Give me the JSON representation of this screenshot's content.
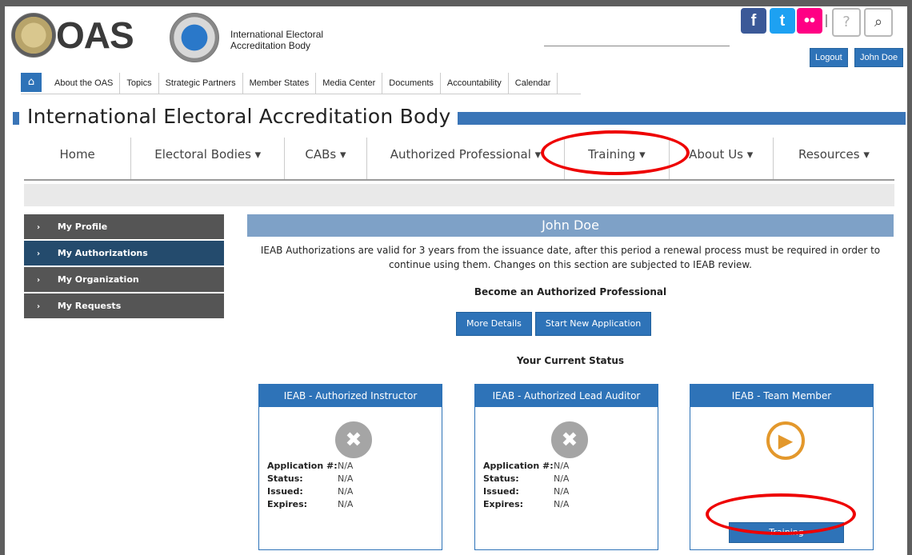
{
  "header": {
    "brand": "OAS",
    "caption": "International Electoral\nAccreditation Body",
    "social": {
      "facebook": "f",
      "twitter": "t",
      "flickr": "••"
    },
    "help": "?",
    "search": "⌕",
    "logout": "Logout",
    "user": "John Doe"
  },
  "oas_nav": {
    "home": "⌂",
    "items": [
      "About the OAS",
      "Topics",
      "Strategic Partners",
      "Member States",
      "Media Center",
      "Documents",
      "Accountability",
      "Calendar"
    ]
  },
  "page_title": "International Electoral Accreditation Body",
  "main_nav": {
    "items": [
      {
        "label": "Home",
        "width": 134
      },
      {
        "label": "Electoral Bodies ▾",
        "width": 192
      },
      {
        "label": "CABs ▾",
        "width": 102
      },
      {
        "label": "Authorized Professional ▾",
        "width": 248
      },
      {
        "label": "Training ▾",
        "width": 130
      },
      {
        "label": "About Us ▾",
        "width": 130
      },
      {
        "label": "Resources ▾",
        "width": 152
      }
    ]
  },
  "sidebar": {
    "items": [
      {
        "label": "My Profile",
        "active": false
      },
      {
        "label": "My Authorizations",
        "active": true
      },
      {
        "label": "My Organization",
        "active": false
      },
      {
        "label": "My Requests",
        "active": false
      }
    ]
  },
  "content": {
    "user_banner": "John Doe",
    "notice": "IEAB Authorizations are valid for 3 years from the issuance date, after this period a renewal process must be required in order to continue using them. Changes on this section are subjected to IEAB review.",
    "become_heading": "Become an Authorized Professional",
    "more_details": "More Details",
    "start_application": "Start New Application",
    "current_status": "Your Current Status"
  },
  "cards": [
    {
      "title": "IEAB - Authorized Instructor",
      "icon": "✖",
      "application_label": "Application #:",
      "application_value": "N/A",
      "status_label": "Status:",
      "status_value": "N/A",
      "issued_label": "Issued:",
      "issued_value": "N/A",
      "expires_label": "Expires:",
      "expires_value": "N/A"
    },
    {
      "title": "IEAB - Authorized Lead Auditor",
      "icon": "✖",
      "application_label": "Application #:",
      "application_value": "N/A",
      "status_label": "Status:",
      "status_value": "N/A",
      "issued_label": "Issued:",
      "issued_value": "N/A",
      "expires_label": "Expires:",
      "expires_value": "N/A"
    },
    {
      "title": "IEAB - Team Member",
      "icon": "▶",
      "button": "Training"
    }
  ],
  "colors": {
    "accent": "#2e73b8",
    "sidebar_active": "#244b6d",
    "sidebar": "#555555",
    "banner": "#7ea1c7",
    "orange": "#e3982c",
    "red_highlight": "#ee0000"
  }
}
